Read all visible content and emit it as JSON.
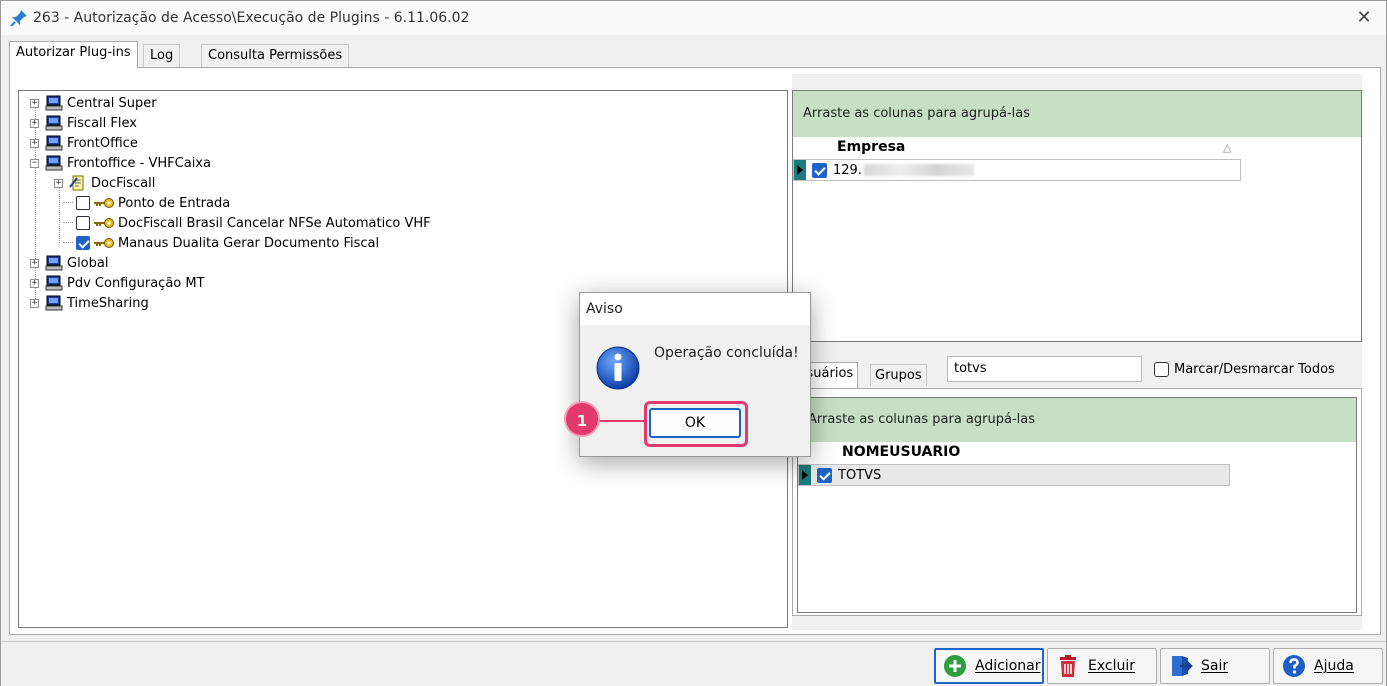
{
  "window": {
    "title": "263 - Autorização de Acesso\\Execução de Plugins - 6.11.06.02",
    "close_glyph": "✕"
  },
  "tabs": [
    {
      "label": "Autorizar Plug-ins"
    },
    {
      "label": "Log"
    },
    {
      "label": "Consulta Permissões"
    }
  ],
  "tree": {
    "nodes": [
      {
        "label": "Central Super",
        "icon": "computer-icon"
      },
      {
        "label": "Fiscall Flex",
        "icon": "computer-icon"
      },
      {
        "label": "FrontOffice",
        "icon": "computer-icon"
      },
      {
        "label": "Frontoffice - VHFCaixa",
        "icon": "computer-icon",
        "expanded": true
      },
      {
        "label": "DocFiscall",
        "icon": "document-icon"
      },
      {
        "label": "Ponto de Entrada",
        "icon": "key-icon",
        "checked": false
      },
      {
        "label": "DocFiscall Brasil Cancelar NFSe Automatico VHF",
        "icon": "key-icon",
        "checked": false
      },
      {
        "label": "Manaus Dualita Gerar Documento Fiscal",
        "icon": "key-icon",
        "checked": true
      },
      {
        "label": "Global",
        "icon": "computer-icon"
      },
      {
        "label": "Pdv Configuração MT",
        "icon": "computer-icon"
      },
      {
        "label": "TimeSharing",
        "icon": "computer-icon"
      }
    ],
    "collapsed_glyph": "+",
    "expanded_glyph": "−"
  },
  "empresa_grid": {
    "group_hint": "Arraste as colunas para agrupá-las",
    "column": "Empresa",
    "sort_glyph": "△",
    "rows": [
      {
        "value": "129."
      }
    ]
  },
  "sub_tabs": [
    {
      "label": "Usuários"
    },
    {
      "label": "Grupos"
    }
  ],
  "search": {
    "value": "totvs"
  },
  "toggle_all_label": "Marcar/Desmarcar Todos",
  "users_grid": {
    "group_hint": "Arraste as colunas para agrupá-las",
    "column": "NOMEUSUARIO",
    "rows": [
      {
        "value": "TOTVS"
      }
    ]
  },
  "dialog": {
    "title": "Aviso",
    "message": "Operação concluída!",
    "ok_label": "OK"
  },
  "annotation": {
    "step": "1",
    "color": "#e23a6c"
  },
  "buttons": {
    "add": "Adicionar",
    "delete": "Excluir",
    "exit": "Sair",
    "help": "Ajuda"
  }
}
